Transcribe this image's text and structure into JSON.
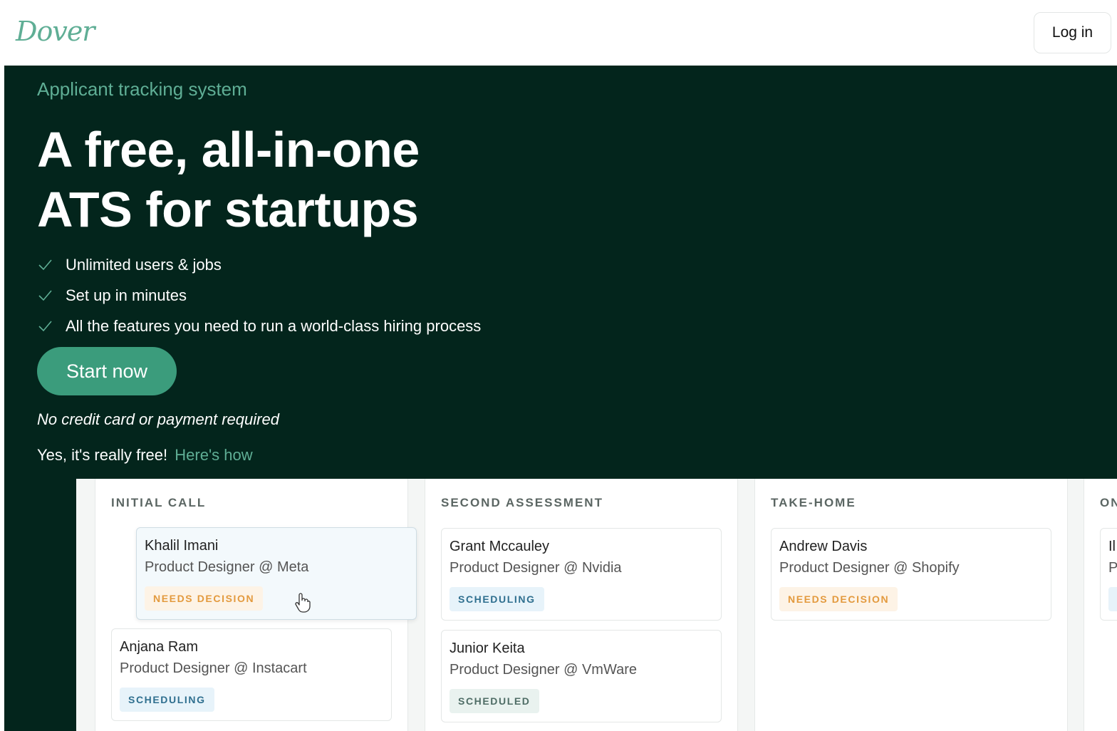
{
  "header": {
    "logo": "Dover",
    "login_label": "Log in"
  },
  "hero": {
    "eyebrow": "Applicant tracking system",
    "headline_line1": "A free, all-in-one",
    "headline_line2": "ATS for startups",
    "features": [
      "Unlimited users & jobs",
      "Set up in minutes",
      "All the features you need to run a world-class hiring process"
    ],
    "cta_label": "Start now",
    "no_cc": "No credit card or payment required",
    "free_text": "Yes, it's really free!",
    "free_link": "Here's how"
  },
  "board": {
    "columns": [
      {
        "title": "INITIAL CALL",
        "cards": [
          {
            "name": "Khalil Imani",
            "role": "Product Designer @ Meta",
            "status": "NEEDS DECISION"
          },
          {
            "name": "Anjana Ram",
            "role": "Product Designer @ Instacart",
            "status": "SCHEDULING"
          }
        ]
      },
      {
        "title": "SECOND ASSESSMENT",
        "cards": [
          {
            "name": "Grant Mccauley",
            "role": "Product Designer @ Nvidia",
            "status": "SCHEDULING"
          },
          {
            "name": "Junior Keita",
            "role": "Product Designer @ VmWare",
            "status": "SCHEDULED"
          }
        ]
      },
      {
        "title": "TAKE-HOME",
        "cards": [
          {
            "name": "Andrew Davis",
            "role": "Product Designer @ Shopify",
            "status": "NEEDS DECISION"
          }
        ]
      },
      {
        "title": "ON",
        "cards": [
          {
            "name": "Il",
            "role": "P",
            "status": ""
          }
        ]
      }
    ]
  },
  "colors": {
    "brand_green": "#5fae95",
    "hero_bg": "#03251c",
    "cta_bg": "#3b9c7c",
    "badge_orange": "#e39a3e",
    "badge_blue": "#2f6f8f"
  },
  "icons": {
    "feature_check": "check-icon",
    "drag_cursor": "hand-cursor-icon"
  }
}
